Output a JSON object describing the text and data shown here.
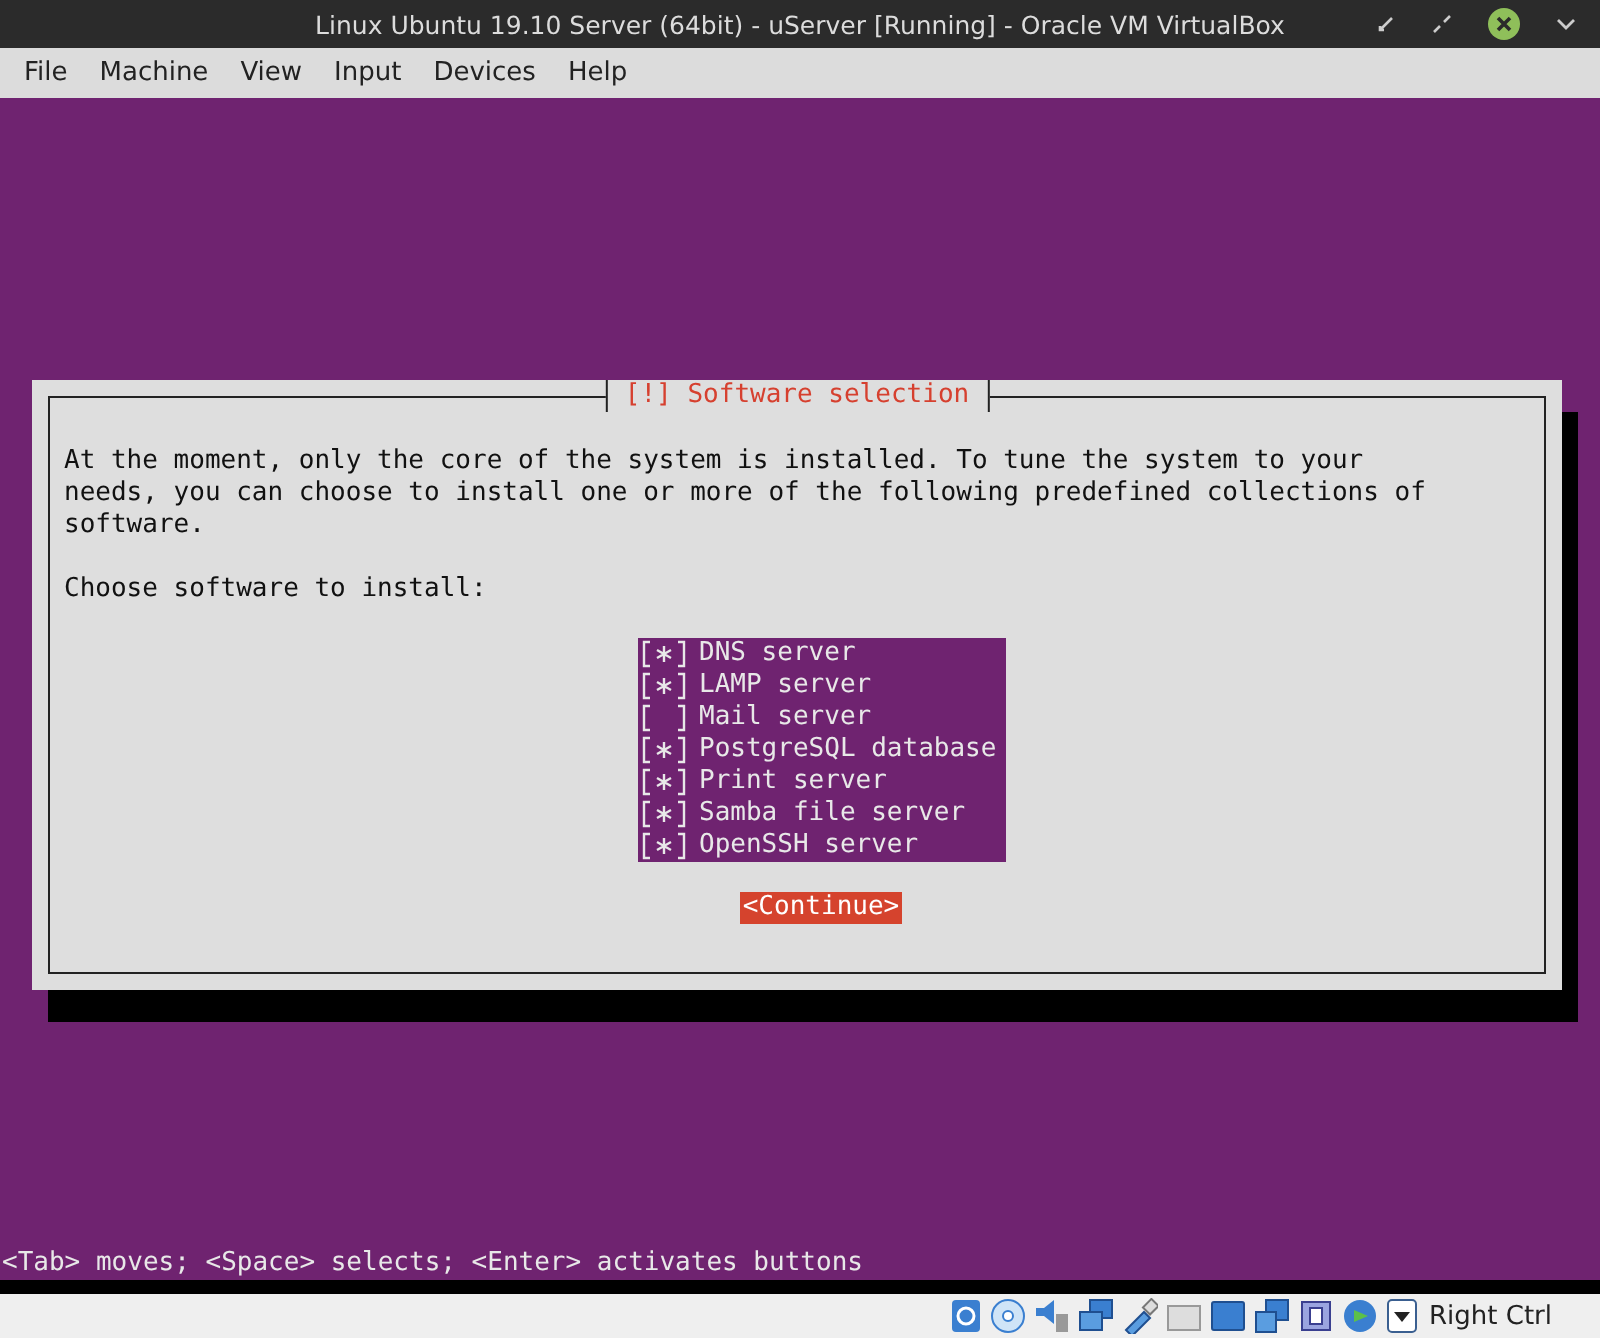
{
  "window": {
    "title": "Linux Ubuntu 19.10 Server (64bit) - uServer [Running] - Oracle VM VirtualBox"
  },
  "menu": [
    "File",
    "Machine",
    "View",
    "Input",
    "Devices",
    "Help"
  ],
  "dialog": {
    "title": "[!] Software selection",
    "description": "At the moment, only the core of the system is installed. To tune the system to your needs, you can choose to install one or more of the following predefined collections of software.",
    "prompt": "Choose software to install:",
    "items": [
      {
        "label": "DNS server",
        "checked": true
      },
      {
        "label": "LAMP server",
        "checked": true
      },
      {
        "label": "Mail server",
        "checked": false
      },
      {
        "label": "PostgreSQL database",
        "checked": true
      },
      {
        "label": "Print server",
        "checked": true
      },
      {
        "label": "Samba file server",
        "checked": true
      },
      {
        "label": "OpenSSH server",
        "checked": true
      }
    ],
    "button": "<Continue>"
  },
  "help_line": "<Tab> moves; <Space> selects; <Enter> activates buttons",
  "status_bar": {
    "host_key": "Right Ctrl"
  }
}
